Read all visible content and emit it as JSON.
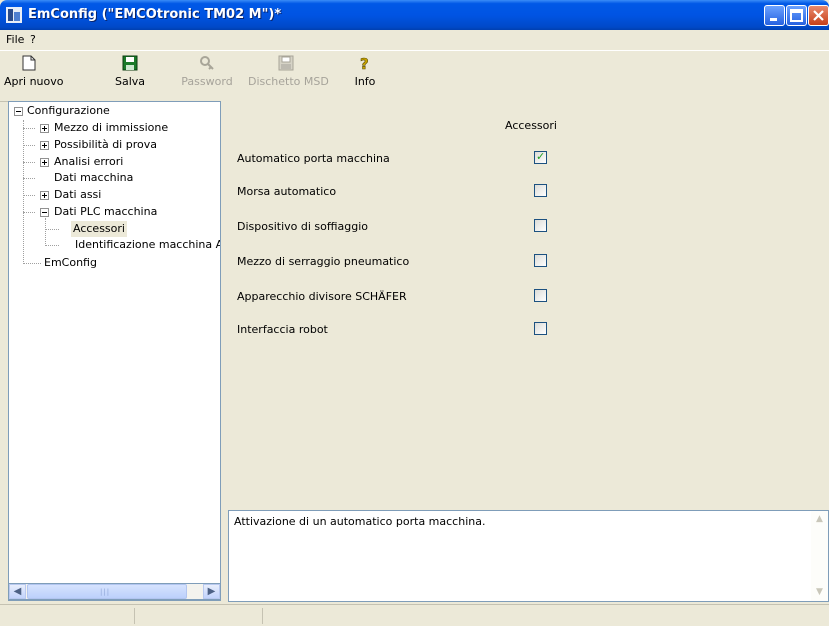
{
  "window": {
    "title": "EmConfig (\"EMCOtronic TM02 M\")*"
  },
  "menu": [
    "File",
    "?"
  ],
  "toolbar": {
    "apri_nuovo": "Apri nuovo",
    "salva": "Salva",
    "password": "Password",
    "dischetto": "Dischetto MSD",
    "info": "Info"
  },
  "tree": {
    "root": "Configurazione",
    "mezzo": "Mezzo di immissione",
    "possibilita": "Possibilità di prova",
    "analisi": "Analisi errori",
    "dati_macchina": "Dati macchina",
    "dati_assi": "Dati assi",
    "dati_plc": "Dati PLC macchina",
    "accessori": "Accessori",
    "identificazione": "Identificazione macchina AC",
    "emconfig": "EmConfig"
  },
  "panel": {
    "column_header": "Accessori",
    "rows": [
      {
        "label": "Automatico porta macchina",
        "checked": true
      },
      {
        "label": "Morsa automatico",
        "checked": false
      },
      {
        "label": "Dispositivo di soffiaggio",
        "checked": false
      },
      {
        "label": "Mezzo di serraggio pneumatico",
        "checked": false
      },
      {
        "label": "Apparecchio divisore SCHÄFER",
        "checked": false
      },
      {
        "label": "Interfaccia robot",
        "checked": false
      }
    ]
  },
  "description": "Attivazione di un automatico porta macchina.",
  "colors": {
    "titlebar": "#0054E3",
    "face": "#ECE9D8",
    "border": "#7F9DB9",
    "check": "#21A121"
  }
}
